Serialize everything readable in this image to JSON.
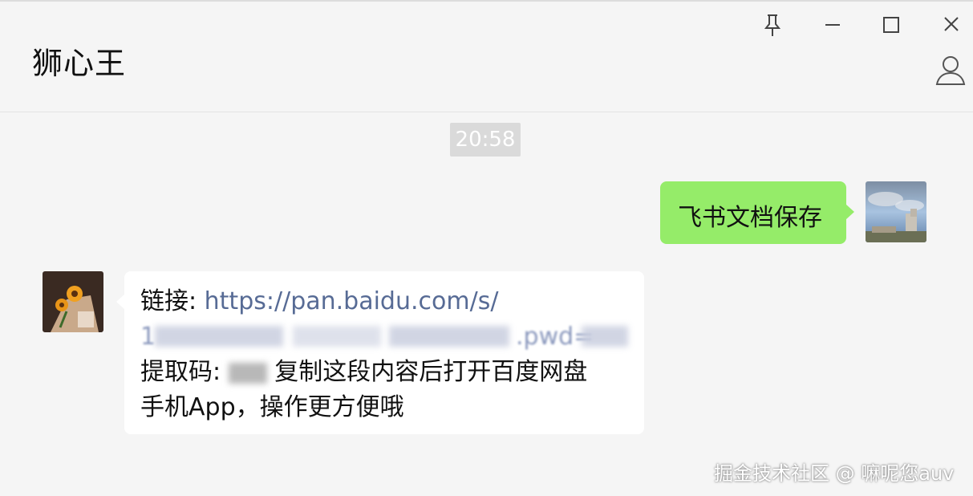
{
  "window": {
    "title": "狮心王",
    "pin_icon": "pin-icon",
    "minimize_icon": "minimize-icon",
    "maximize_icon": "maximize-icon",
    "close_icon": "close-icon",
    "profile_icon": "person-icon"
  },
  "messages": [
    {
      "type": "timestamp",
      "text": "20:58"
    },
    {
      "type": "outgoing",
      "text": "飞书文档保存",
      "avatar": "avatar-self"
    },
    {
      "type": "incoming",
      "avatar": "avatar-contact",
      "link_label": "链接: ",
      "link_url": "https://pan.baidu.com/s/",
      "link_url_cont_start": "1",
      "link_url_cont_end": ".pwd=",
      "code_label": "提取码: ",
      "code_value": "",
      "message_text_1": " 复制这段内容后打开百度网盘",
      "message_text_2": "手机App，操作更方便哦"
    }
  ],
  "watermark": "掘金技术社区 @ 嘛呢您auv",
  "colors": {
    "outgoing_bubble": "#95ec69",
    "incoming_bubble": "#ffffff",
    "link": "#576b95",
    "background": "#f5f5f5"
  }
}
